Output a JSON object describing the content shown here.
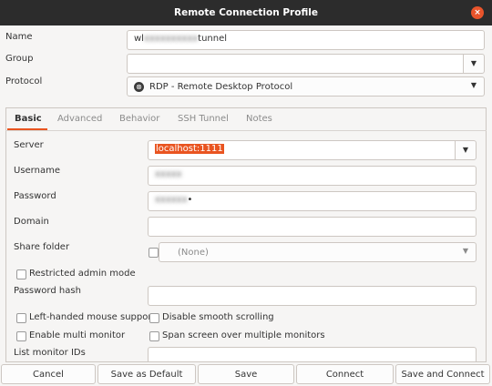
{
  "window": {
    "title": "Remote Connection Profile",
    "close_glyph": "×"
  },
  "profile": {
    "name_label": "Name",
    "name_value_prefix": "wl",
    "name_value_redacted": "xxxxxxxxxx",
    "name_value_suffix": "tunnel",
    "group_label": "Group",
    "group_value": "",
    "protocol_label": "Protocol",
    "protocol_value": "RDP - Remote Desktop Protocol",
    "protocol_icon": "rdp-icon"
  },
  "tabs": [
    {
      "label": "Basic",
      "active": true
    },
    {
      "label": "Advanced",
      "active": false
    },
    {
      "label": "Behavior",
      "active": false
    },
    {
      "label": "SSH Tunnel",
      "active": false
    },
    {
      "label": "Notes",
      "active": false
    }
  ],
  "basic": {
    "server_label": "Server",
    "server_value": "localhost:1111",
    "username_label": "Username",
    "username_value_redacted": "xxxxx",
    "password_label": "Password",
    "password_value_redacted": "xxxxxx",
    "password_value_suffix": "•",
    "domain_label": "Domain",
    "domain_value": "",
    "share_folder_label": "Share folder",
    "share_folder_value": "(None)",
    "restricted_admin_label": "Restricted admin mode",
    "password_hash_label": "Password hash",
    "left_handed_label": "Left-handed mouse support",
    "disable_smooth_label": "Disable smooth scrolling",
    "enable_multi_label": "Enable multi monitor",
    "span_screen_label": "Span screen over multiple monitors",
    "list_monitor_label": "List monitor IDs"
  },
  "buttons": {
    "cancel": "Cancel",
    "save_default": "Save as Default",
    "save": "Save",
    "connect": "Connect",
    "save_connect": "Save and Connect"
  },
  "colors": {
    "accent": "#e95420",
    "titlebar": "#2c2c2c",
    "close": "#e9542b"
  }
}
